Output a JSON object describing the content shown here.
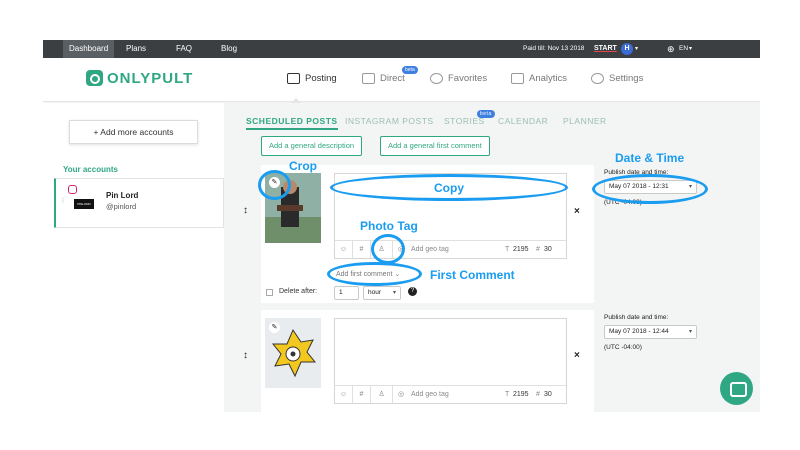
{
  "topbar": {
    "tabs": [
      "Dashboard",
      "Plans",
      "FAQ",
      "Blog"
    ],
    "paid_till": "Paid till: Nov 13 2018",
    "start": "START",
    "avatar_letter": "H",
    "language": "EN"
  },
  "header": {
    "logo": "ONLYPULT",
    "nav": [
      {
        "label": "Posting",
        "icon": "image-icon"
      },
      {
        "label": "Direct",
        "icon": "message-icon",
        "badge": "beta"
      },
      {
        "label": "Favorites",
        "icon": "star-icon"
      },
      {
        "label": "Analytics",
        "icon": "chart-icon"
      },
      {
        "label": "Settings",
        "icon": "gear-icon"
      }
    ]
  },
  "sidebar": {
    "add_accounts": "+  Add more accounts",
    "your_accounts": "Your accounts",
    "account": {
      "name": "Pin Lord",
      "handle": "@pinlord",
      "thumb_text": "PINLORD"
    }
  },
  "main": {
    "tabs": [
      {
        "label": "SCHEDULED POSTS"
      },
      {
        "label": "INSTAGRAM POSTS"
      },
      {
        "label": "STORIES",
        "badge": "beta"
      },
      {
        "label": "CALENDAR"
      },
      {
        "label": "PLANNER"
      }
    ],
    "add_description": "Add a general description",
    "add_first_comment": "Add a general first comment"
  },
  "posts": [
    {
      "geo_placeholder": "Add geo tag",
      "count_chars": "2195",
      "count_tags": "30",
      "first_comment": "Add first comment",
      "delete_after_label": "Delete after:",
      "delete_after_value": "1",
      "delete_after_unit": "hour",
      "publish_label": "Publish date and time:",
      "publish_value": "May 07 2018 - 12:31",
      "timezone": "(UTC -04:00)"
    },
    {
      "geo_placeholder": "Add geo tag",
      "count_chars": "2195",
      "count_tags": "30",
      "publish_label": "Publish date and time:",
      "publish_value": "May 07 2018 - 12:44",
      "timezone": "(UTC -04:00)"
    }
  ],
  "annotations": {
    "crop": "Crop",
    "copy": "Copy",
    "photo_tag": "Photo Tag",
    "first_comment": "First Comment",
    "date_time": "Date & Time"
  },
  "colors": {
    "brand": "#2fa783",
    "annotation": "#1a9cf0",
    "topbar": "#3b3f42"
  }
}
